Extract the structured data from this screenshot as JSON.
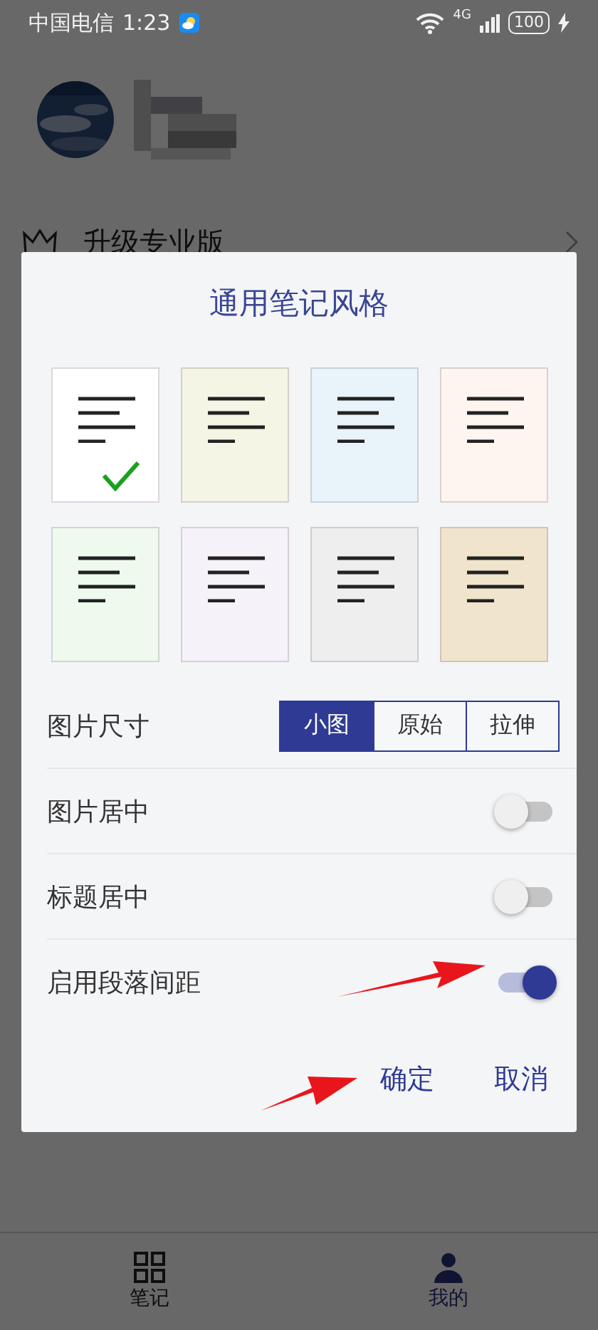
{
  "status_bar": {
    "carrier": "中国电信",
    "time": "1:23",
    "network": "4G",
    "battery": "100"
  },
  "menu": [
    {
      "label": "升级专业版"
    }
  ],
  "dialog": {
    "title": "通用笔记风格",
    "styles": [
      {
        "color": "#ffffff",
        "selected": true
      },
      {
        "color": "#f5f5e6",
        "selected": false
      },
      {
        "color": "#e8f3fa",
        "selected": false
      },
      {
        "color": "#fef5f0",
        "selected": false
      },
      {
        "color": "#effaef",
        "selected": false
      },
      {
        "color": "#f6f2fa",
        "selected": false
      },
      {
        "color": "#eeeeee",
        "selected": false
      },
      {
        "color": "#f0e4cc",
        "selected": false
      }
    ],
    "settings": [
      {
        "kind": "segmented",
        "label": "图片尺寸",
        "options": [
          {
            "label": "小图",
            "selected": true
          },
          {
            "label": "原始",
            "selected": false
          },
          {
            "label": "拉伸",
            "selected": false
          }
        ]
      },
      {
        "kind": "toggle",
        "label": "图片居中",
        "on": false
      },
      {
        "kind": "toggle",
        "label": "标题居中",
        "on": false
      },
      {
        "kind": "toggle",
        "label": "启用段落间距",
        "on": true
      }
    ],
    "buttons": [
      {
        "label": "确定"
      },
      {
        "label": "取消"
      }
    ]
  },
  "bottom_nav": [
    {
      "label": "笔记",
      "selected": false
    },
    {
      "label": "我的",
      "selected": true
    }
  ]
}
